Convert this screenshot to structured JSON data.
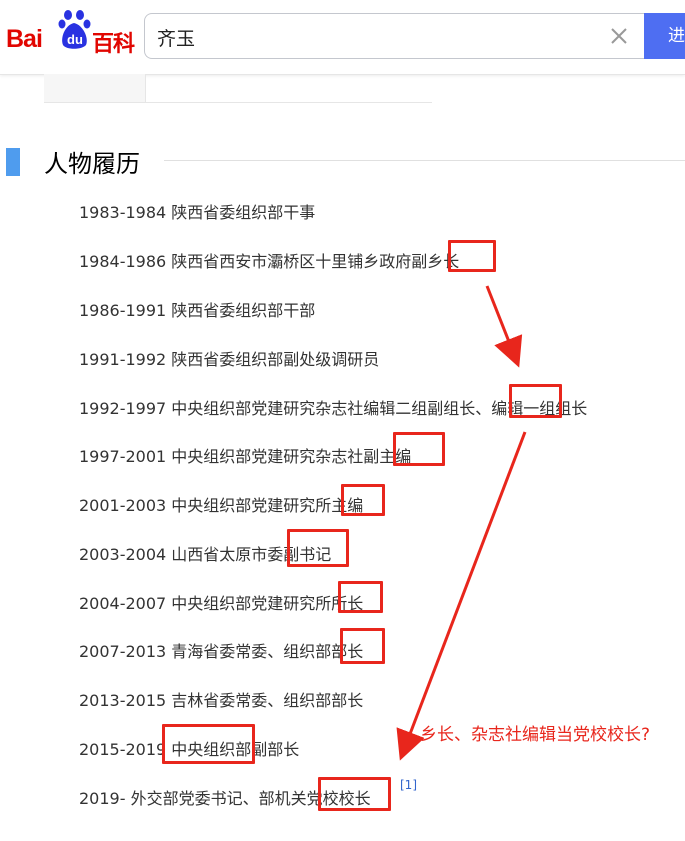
{
  "header": {
    "logo_text_bai": "Bai",
    "logo_text_du": "du",
    "logo_text_baike": "百科",
    "search_value": "齐玉",
    "search_button_label": "进",
    "clear_icon": "close-icon"
  },
  "section": {
    "title": "人物履历"
  },
  "entries": [
    "1983-1984 陕西省委组织部干事",
    "1984-1986 陕西省西安市灞桥区十里铺乡政府副乡长",
    "1986-1991 陕西省委组织部干部",
    "1991-1992 陕西省委组织部副处级调研员",
    "1992-1997 中央组织部党建研究杂志社编辑二组副组长、编辑一组组长",
    "1997-2001 中央组织部党建研究杂志社副主编",
    "2001-2003 中央组织部党建研究所主编",
    "2003-2004 山西省太原市委副书记",
    "2004-2007 中央组织部党建研究所所长",
    "2007-2013 青海省委常委、组织部部长",
    "2013-2015 吉林省委常委、组织部部长",
    "2015-2019 中央组织部副部长",
    "2019- 外交部党委书记、部机关党校校长"
  ],
  "reference_mark": "[1]",
  "annotation": {
    "note": "乡长、杂志社编辑当党校校长?",
    "color": "#e8261c"
  },
  "colors": {
    "brand_red": "#e10601",
    "brand_blue": "#4e6ef2",
    "section_bar": "#4f9cee",
    "link_blue": "#3366cc"
  }
}
